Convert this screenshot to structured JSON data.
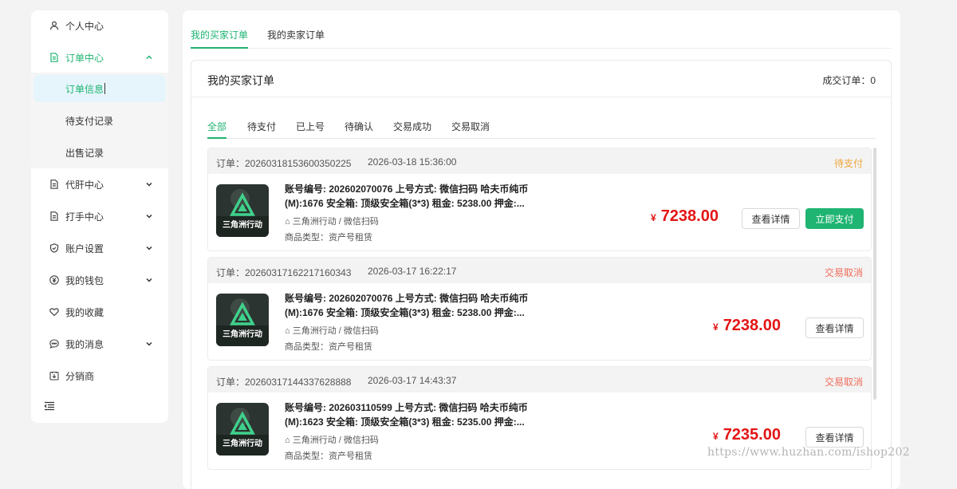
{
  "sidebar": {
    "items": [
      {
        "label": "个人中心",
        "icon": "user-icon"
      },
      {
        "label": "订单中心",
        "icon": "order-doc-icon"
      },
      {
        "label": "代肝中心",
        "icon": "doc-icon"
      },
      {
        "label": "打手中心",
        "icon": "doc-icon"
      },
      {
        "label": "账户设置",
        "icon": "shield-icon"
      },
      {
        "label": "我的钱包",
        "icon": "yen-coin-icon"
      },
      {
        "label": "我的收藏",
        "icon": "heart-icon"
      },
      {
        "label": "我的消息",
        "icon": "chat-bubble-icon"
      },
      {
        "label": "分销商",
        "icon": "share-box-icon"
      }
    ],
    "subitems": [
      {
        "label": "订单信息"
      },
      {
        "label": "待支付记录"
      },
      {
        "label": "出售记录"
      }
    ]
  },
  "top_tabs": [
    "我的买家订单",
    "我的卖家订单"
  ],
  "panel": {
    "title": "我的买家订单",
    "deal_count": "成交订单：0"
  },
  "status_tabs": [
    "全部",
    "待支付",
    "已上号",
    "待确认",
    "交易成功",
    "交易取消"
  ],
  "orders": [
    {
      "order_no": "订单：20260318153600350225",
      "time": "2026-03-18 15:36:00",
      "status": "待支付",
      "desc": "账号编号: 202602070076 上号方式: 微信扫码 哈夫币纯币(M):1676 安全箱: 顶级安全箱(3*3) 租金: 5238.00 押金:...",
      "meta1": "三角洲行动 / 微信扫码",
      "meta2": "商品类型：资产号租赁",
      "currency": "¥",
      "price": "7238.00",
      "detail_label": "查看详情",
      "pay_label": "立即支付"
    },
    {
      "order_no": "订单：20260317162217160343",
      "time": "2026-03-17 16:22:17",
      "status": "交易取消",
      "desc": "账号编号: 202602070076 上号方式: 微信扫码 哈夫币纯币(M):1676 安全箱: 顶级安全箱(3*3) 租金: 5238.00 押金:...",
      "meta1": "三角洲行动 / 微信扫码",
      "meta2": "商品类型：资产号租赁",
      "currency": "¥",
      "price": "7238.00",
      "detail_label": "查看详情"
    },
    {
      "order_no": "订单：20260317144337628888",
      "time": "2026-03-17 14:43:37",
      "status": "交易取消",
      "desc": "账号编号: 202603110599 上号方式: 微信扫码 哈夫币纯币(M):1623 安全箱: 顶级安全箱(3*3) 租金: 5235.00 押金:...",
      "meta1": "三角洲行动 / 微信扫码",
      "meta2": "商品类型：资产号租赁",
      "currency": "¥",
      "price": "7235.00",
      "detail_label": "查看详情"
    }
  ],
  "game_logo_text": "三角洲行动",
  "watermark": "https://www.huzhan.com/ishop202",
  "colors": {
    "accent": "#1fb472",
    "price": "#e31515",
    "pending": "#f0a63a",
    "cancelled": "#f06c5a"
  }
}
